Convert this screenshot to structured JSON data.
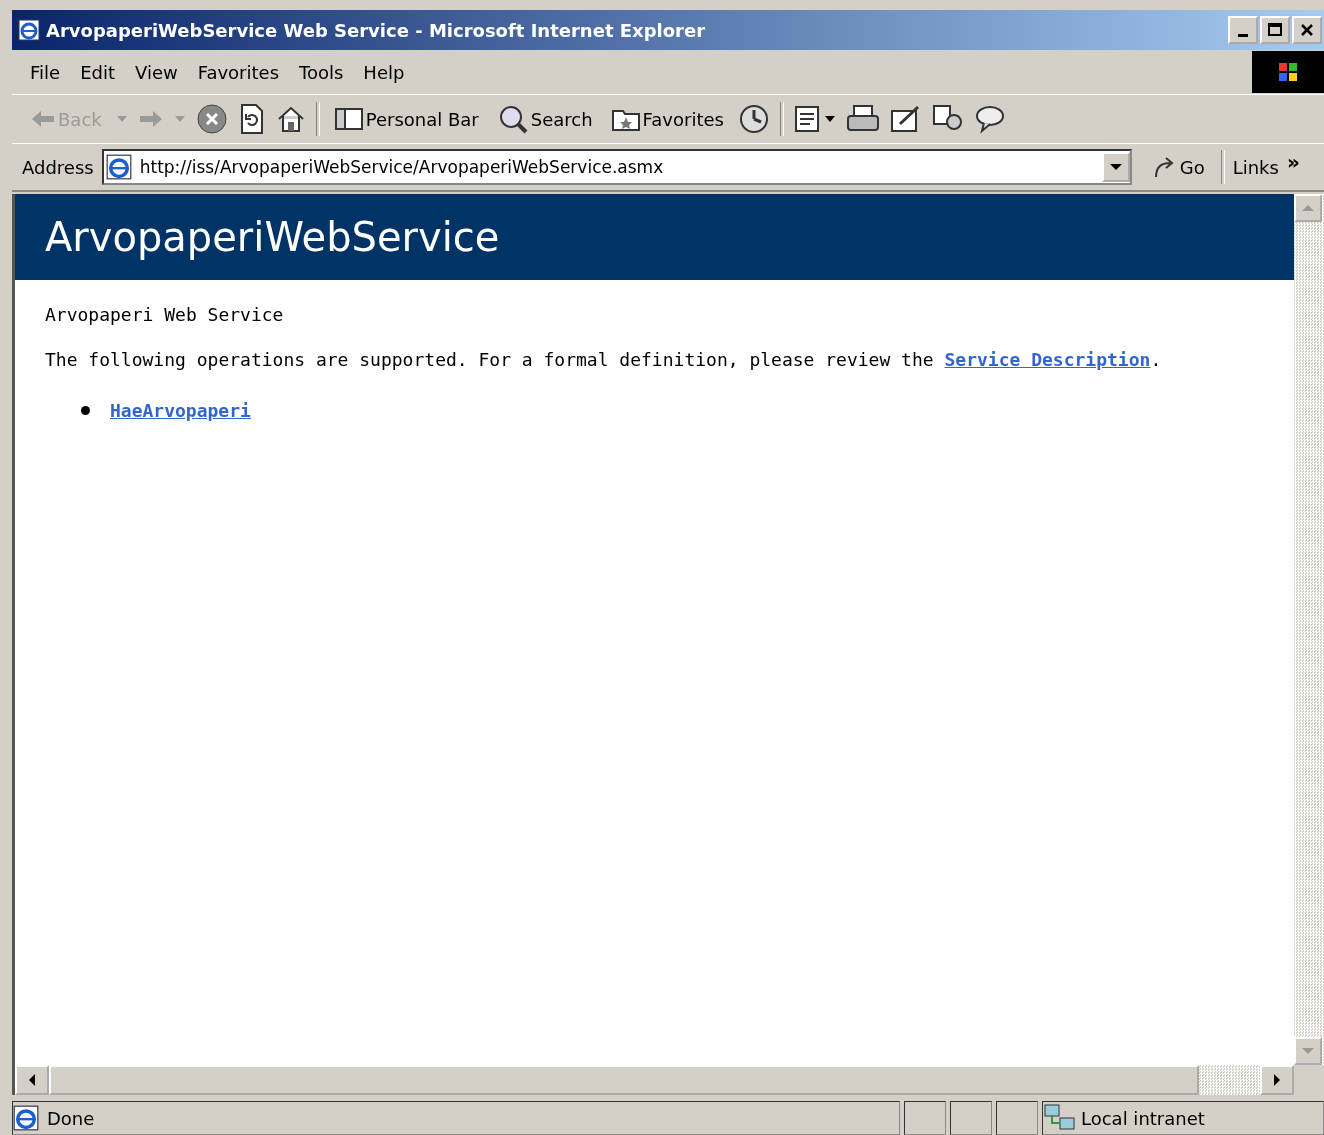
{
  "window": {
    "title": "ArvopaperiWebService Web Service - Microsoft Internet Explorer"
  },
  "menu": [
    {
      "label": "File"
    },
    {
      "label": "Edit"
    },
    {
      "label": "View"
    },
    {
      "label": "Favorites"
    },
    {
      "label": "Tools"
    },
    {
      "label": "Help"
    }
  ],
  "toolbar": [
    {
      "kind": "back",
      "label": "Back",
      "disabled": true
    },
    {
      "kind": "personal",
      "label": "Personal Bar",
      "disabled": false
    },
    {
      "kind": "search",
      "label": "Search",
      "disabled": false
    },
    {
      "kind": "favorites",
      "label": "Favorites",
      "disabled": false
    }
  ],
  "address": {
    "label": "Address",
    "value": "http://iss/ArvopaperiWebService/ArvopaperiWebService.asmx",
    "go": "Go",
    "links": "Links",
    "more": "»"
  },
  "page": {
    "heading": "ArvopaperiWebService",
    "description": "Arvopaperi Web Service",
    "intro": "The following operations are supported. For a formal definition, please review the ",
    "intro_link": "Service Description",
    "intro_end": ".",
    "operations": [
      {
        "label": "HaeArvopaperi"
      }
    ]
  },
  "status_bar": {
    "text": "Done",
    "zone": "Local intranet"
  }
}
